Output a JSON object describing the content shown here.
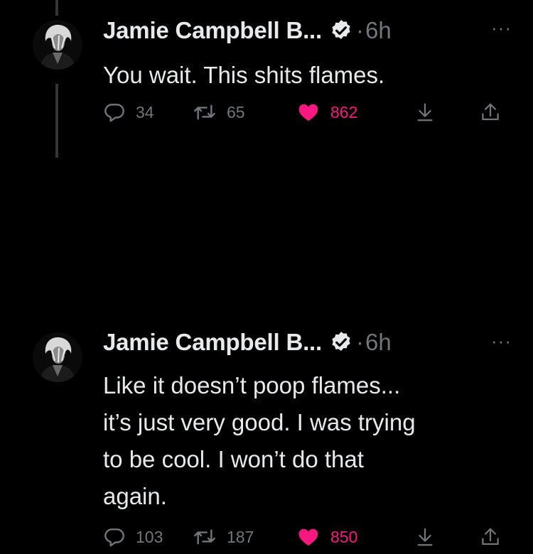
{
  "tweets": [
    {
      "author": "Jamie Campbell B...",
      "separator": "·",
      "time": "6h",
      "more": "···",
      "text": [
        "You wait. This shits flames."
      ],
      "replies": "34",
      "retweets": "65",
      "likes": "862",
      "liked": true
    },
    {
      "author": "Jamie Campbell B...",
      "separator": "·",
      "time": "6h",
      "more": "···",
      "text": [
        "Like it doesn’t poop flames...",
        "it’s just very good. I was trying",
        "to be cool. I won’t do that",
        "again."
      ],
      "replies": "103",
      "retweets": "187",
      "likes": "850",
      "liked": true
    }
  ],
  "colors": {
    "background": "#000000",
    "text": "#e7e9ea",
    "muted": "#71767b",
    "like": "#f91880",
    "thread_line": "#333639",
    "verified_badge": "#e7e9ea"
  },
  "icons": {
    "verified": "verified-badge-icon",
    "reply": "reply-icon",
    "retweet": "retweet-icon",
    "like": "heart-filled-icon",
    "bookmark": "download-icon",
    "share": "share-icon",
    "more": "more-options-icon"
  }
}
